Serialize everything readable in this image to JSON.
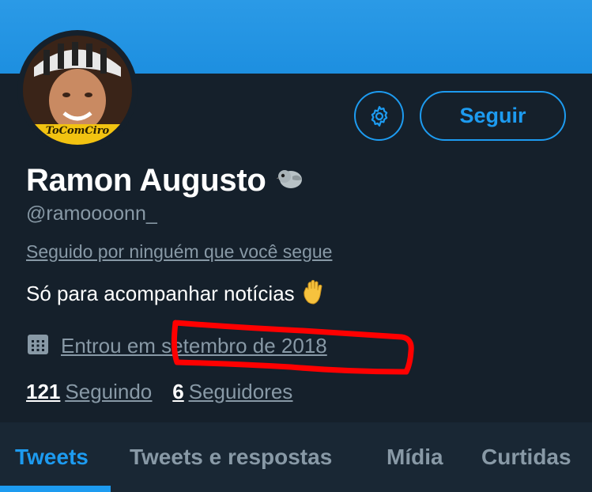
{
  "profile": {
    "display_name": "Ramon Augusto",
    "handle": "@ramoooonn_",
    "followed_by": "Seguido por ninguém que você segue",
    "bio": "Só para acompanhar notícias",
    "joined": "Entrou em setembro de 2018",
    "avatar_caption": "ToComCiro"
  },
  "actions": {
    "follow_label": "Seguir",
    "settings_icon": "gear-icon"
  },
  "stats": {
    "following_count": "121",
    "following_label": "Seguindo",
    "followers_count": "6",
    "followers_label": "Seguidores"
  },
  "tabs": [
    {
      "label": "Tweets",
      "active": true
    },
    {
      "label": "Tweets e respostas",
      "active": false
    },
    {
      "label": "Mídia",
      "active": false
    },
    {
      "label": "Curtidas",
      "active": false
    }
  ],
  "icons": {
    "bird": "bird-icon",
    "hand": "raised-hand-emoji-icon",
    "calendar": "calendar-icon"
  },
  "colors": {
    "background": "#15202b",
    "banner": "#1d8fe0",
    "accent": "#1d9bf0",
    "secondary_text": "#8899a6",
    "annotation": "#ff0000"
  }
}
